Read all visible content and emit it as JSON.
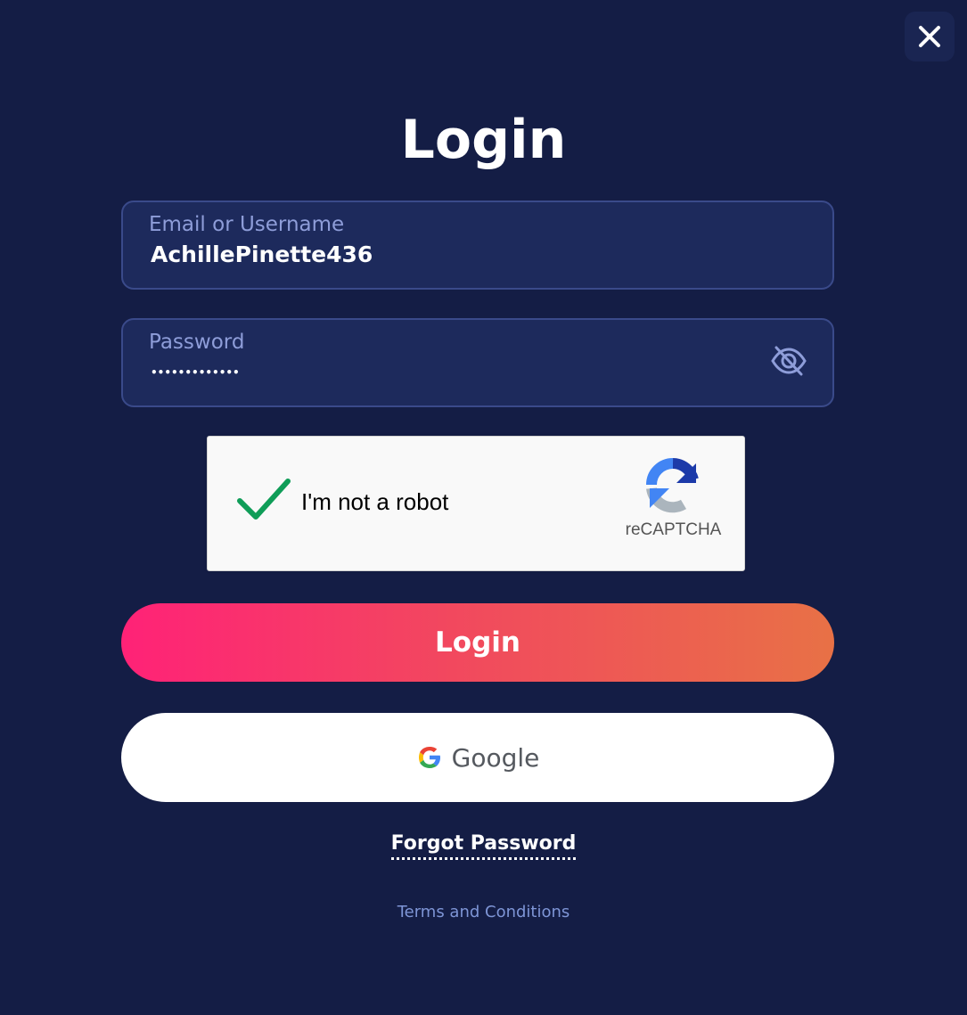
{
  "modal": {
    "title": "Login",
    "close_icon": "close-icon"
  },
  "form": {
    "email": {
      "label": "Email or Username",
      "value": "AchillePinette436"
    },
    "password": {
      "label": "Password",
      "masked_value": "•••••••••••••",
      "toggle_icon": "eye-slash-icon"
    }
  },
  "captcha": {
    "checked": true,
    "label": "I'm not a robot",
    "brand": "reCAPTCHA",
    "check_color": "#0f9d58"
  },
  "buttons": {
    "login_label": "Login",
    "google_label": "Google"
  },
  "links": {
    "forgot_password": "Forgot Password",
    "terms": "Terms and Conditions"
  },
  "colors": {
    "background": "#141d45",
    "field_bg": "#1d2a5c",
    "field_border": "#3a4a8a",
    "label": "#8e9dd9",
    "gradient_start": "#ff2277",
    "gradient_end": "#e87146",
    "terms_link": "#7e95d6"
  }
}
